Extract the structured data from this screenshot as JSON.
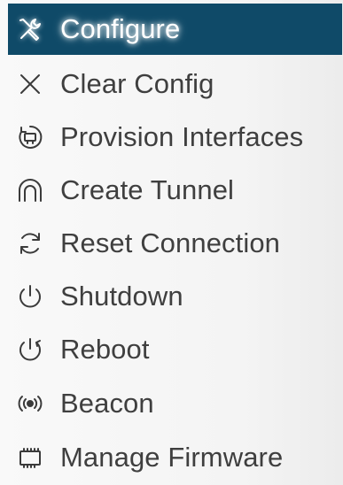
{
  "menu": {
    "items": [
      {
        "label": "Configure",
        "icon": "tools-icon",
        "active": true
      },
      {
        "label": "Clear Config",
        "icon": "close-icon"
      },
      {
        "label": "Provision Interfaces",
        "icon": "provision-icon"
      },
      {
        "label": "Create Tunnel",
        "icon": "tunnel-icon"
      },
      {
        "label": "Reset Connection",
        "icon": "refresh-icon"
      },
      {
        "label": "Shutdown",
        "icon": "power-icon"
      },
      {
        "label": "Reboot",
        "icon": "reboot-icon"
      },
      {
        "label": "Beacon",
        "icon": "beacon-icon"
      },
      {
        "label": "Manage Firmware",
        "icon": "chip-icon"
      }
    ],
    "colors": {
      "active_background": "#0f4a68",
      "text": "#3f3f3f",
      "active_text": "#ffffff"
    }
  }
}
